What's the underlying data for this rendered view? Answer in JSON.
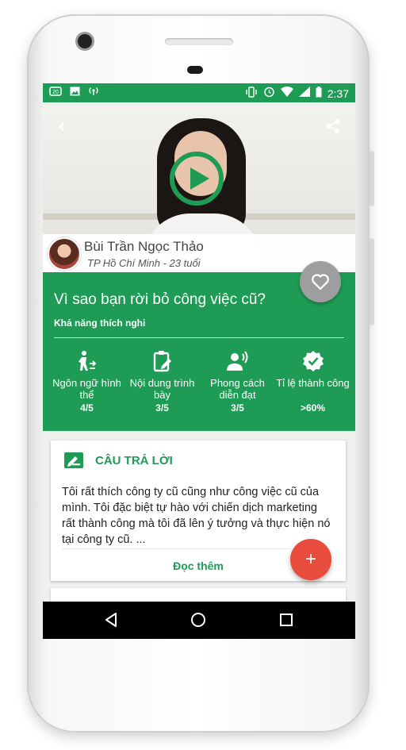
{
  "status_bar": {
    "time": "2:37",
    "left_icons": [
      "notification-icon",
      "image-icon",
      "radio-icon"
    ],
    "right_icons": [
      "vibrate-icon",
      "alarm-icon",
      "wifi-icon",
      "signal-icon",
      "battery-icon"
    ]
  },
  "video": {
    "icons": [
      "back-icon",
      "share-icon",
      "play-icon"
    ]
  },
  "profile": {
    "name": "Bùi Trần Ngọc Thảo",
    "subtitle": "TP Hồ Chí Minh - 23 tuổi"
  },
  "question": {
    "title": "Vì sao bạn rời bỏ công việc cũ?",
    "skill": "Khả năng thích nghi",
    "favorite_icon": "heart-outline-icon",
    "metrics": [
      {
        "icon": "body-language-icon",
        "label": "Ngôn ngữ hình thể",
        "value": "4/5"
      },
      {
        "icon": "clipboard-edit-icon",
        "label": "Nội dung trình bày",
        "value": "3/5"
      },
      {
        "icon": "speaker-person-icon",
        "label": "Phong cách diễn đạt",
        "value": "3/5"
      },
      {
        "icon": "verified-badge-icon",
        "label": "Tỉ lệ thành công",
        "value": ">60%"
      }
    ]
  },
  "answer": {
    "title": "CÂU TRẢ LỜI",
    "icon": "edit-note-icon",
    "text": "Tôi rất thích công ty cũ cũng như công việc cũ của mình. Tôi đặc biệt tự hào với chiến dịch marketing rất thành công mà tôi đã lên ý tưởng và thực hiện nó tại công ty cũ.  ...",
    "read_more": "Đọc thêm"
  },
  "fab": {
    "label": "+"
  },
  "colors": {
    "primary": "#1e9c56",
    "fab": "#e84c3d",
    "heart_button": "#9e9e9e"
  },
  "navigation": {
    "icons": [
      "back-triangle-icon",
      "home-circle-icon",
      "recents-square-icon"
    ]
  }
}
